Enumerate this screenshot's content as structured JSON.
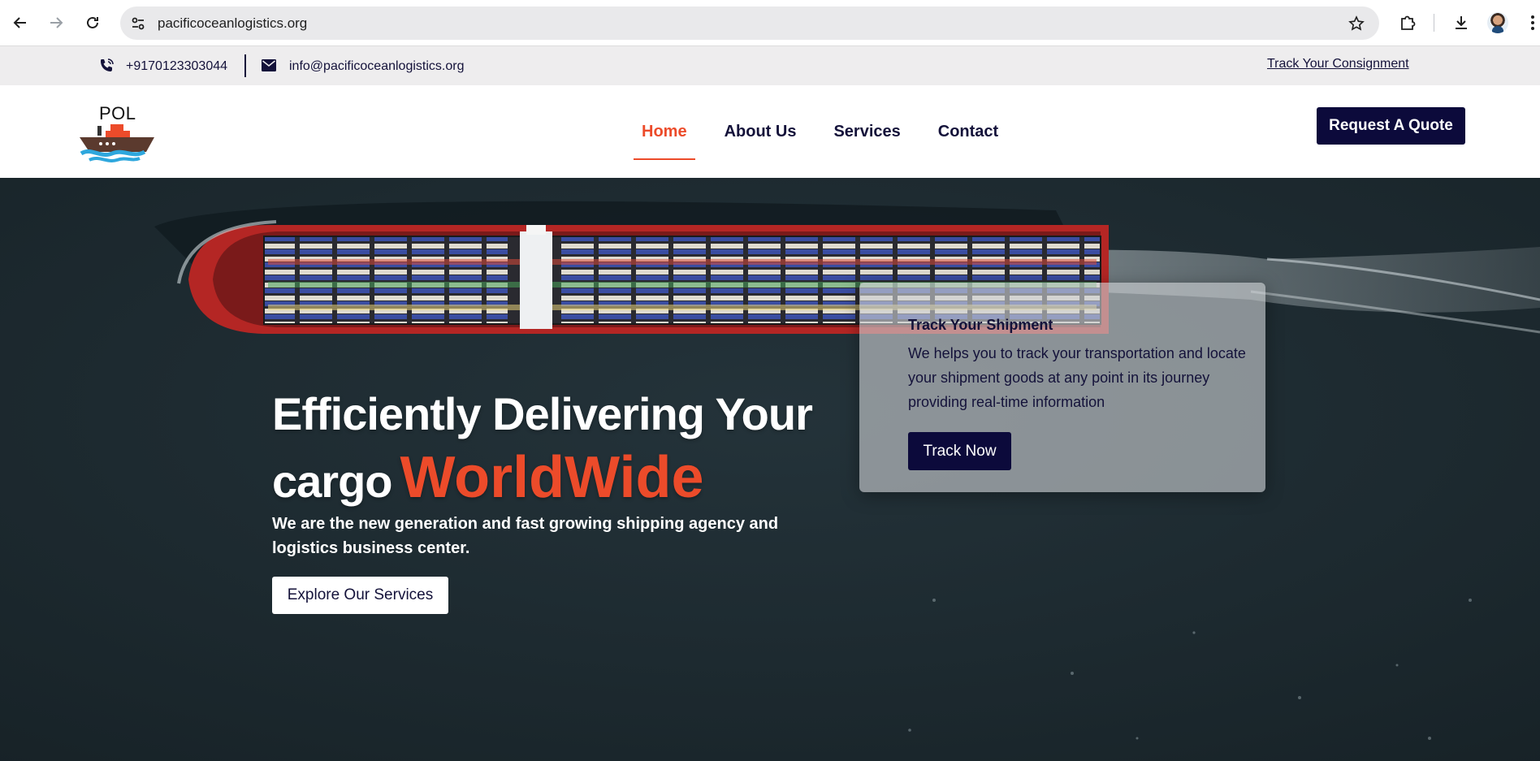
{
  "browser": {
    "url": "pacificoceanlogistics.org",
    "icons": [
      "back-icon",
      "forward-icon",
      "reload-icon",
      "site-info-icon",
      "bookmark-star-icon",
      "extensions-icon",
      "download-icon",
      "profile-avatar",
      "more-menu-icon"
    ]
  },
  "topbar": {
    "phone": "+9170123303044",
    "email": "info@pacificoceanlogistics.org",
    "track_link": "Track Your Consignment"
  },
  "header": {
    "logo_text": "POL",
    "menu": [
      {
        "label": "Home",
        "active": true
      },
      {
        "label": "About Us",
        "active": false
      },
      {
        "label": "Services",
        "active": false
      },
      {
        "label": "Contact",
        "active": false
      }
    ],
    "quote_button": "Request A Quote"
  },
  "hero": {
    "title_line1": "Efficiently Delivering Your",
    "title_line2": "cargo",
    "title_accent": "WorldWide",
    "subtitle": "We are the new generation and fast growing shipping agency and logistics business center.",
    "cta": "Explore Our Services"
  },
  "track_card": {
    "title": "Track Your Shipment",
    "text": "We helps you to track your transportation and locate your shipment goods at any point in its journey providing real-time information",
    "button": "Track Now"
  },
  "colors": {
    "accent": "#ec4b2a",
    "navy": "#0c0a3b",
    "text": "#14123a",
    "topbar_bg": "#eeedee",
    "sea": "#1d2a2f"
  }
}
